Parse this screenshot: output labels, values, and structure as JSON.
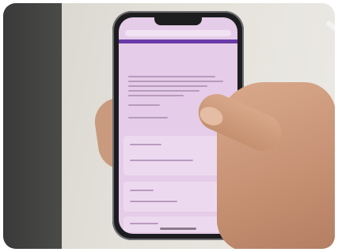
{
  "scene": {
    "description_colors": {
      "screen": "#e5cce8",
      "accent": "#6a3aa8",
      "phone_body": "#1d1d20",
      "skin": "#c99a7e"
    }
  },
  "phone_screen": {
    "title": "",
    "blurred": true
  }
}
